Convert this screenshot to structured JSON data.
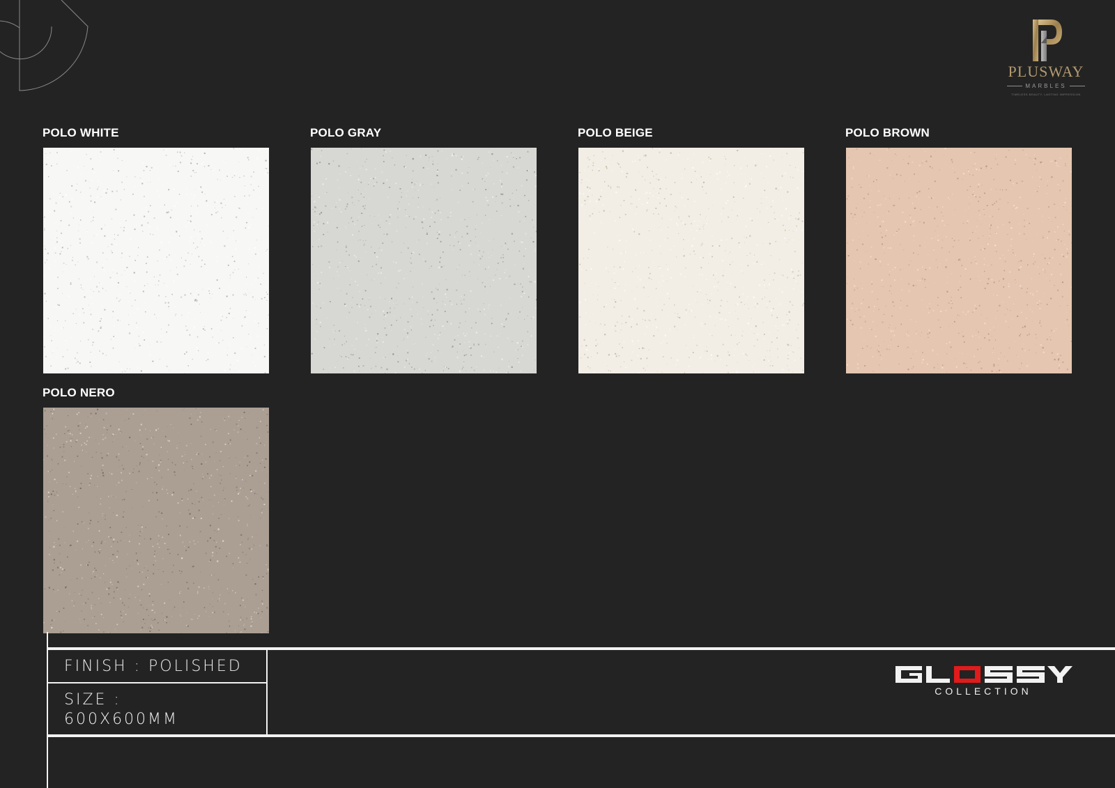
{
  "brand": {
    "name": "PLUSWAY",
    "sub": "MARBLES",
    "tagline": "TIMELESS BEAUTY, LASTING IMPRESSION",
    "gold_color": "#b29a6e"
  },
  "tiles": [
    {
      "label": "POLO WHITE",
      "base": "#f7f7f5",
      "speck_dark": "#a9a9a3",
      "speck_light": "#ffffff"
    },
    {
      "label": "POLO GRAY",
      "base": "#d7d7d3",
      "speck_dark": "#8d8d88",
      "speck_light": "#f3f3f0"
    },
    {
      "label": "POLO BEIGE",
      "base": "#f2eee6",
      "speck_dark": "#bdb3a0",
      "speck_light": "#ffffff"
    },
    {
      "label": "POLO BROWN",
      "base": "#e5c6b0",
      "speck_dark": "#b48f78",
      "speck_light": "#f8e6d8"
    },
    {
      "label": "POLO NERO",
      "base": "#ab9f94",
      "speck_dark": "#6f655c",
      "speck_light": "#e8e1da"
    }
  ],
  "specs": {
    "finish": "FINISH : POLISHED",
    "size_label": "SIZE :",
    "size_value": "600X600MM"
  },
  "collection": {
    "name": "GLOSSY",
    "sub": "COLLECTION",
    "accent_color": "#e11b1b"
  }
}
